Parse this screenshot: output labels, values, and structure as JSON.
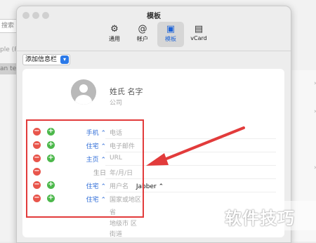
{
  "background": {
    "search_placeholder": "搜索",
    "list_item_1": "ple (P",
    "list_item_2": "an te"
  },
  "window": {
    "title": "模板",
    "tabs": [
      {
        "label": "通用",
        "icon": "gear-icon",
        "glyph": "⚙",
        "active": false
      },
      {
        "label": "帐户",
        "icon": "at-icon",
        "glyph": "@",
        "active": false
      },
      {
        "label": "模板",
        "icon": "template-icon",
        "glyph": "▣",
        "active": true
      },
      {
        "label": "vCard",
        "icon": "vcard-icon",
        "glyph": "▤",
        "active": false
      }
    ],
    "add_field_label": "添加信息栏"
  },
  "card": {
    "name_placeholder": "姓氏  名字",
    "company_placeholder": "公司",
    "rows": [
      {
        "label": "手机",
        "value": "电话",
        "minus": true,
        "plus": true,
        "chevron": true
      },
      {
        "label": "住宅",
        "value": "电子邮件",
        "minus": true,
        "plus": true,
        "chevron": true
      },
      {
        "label": "主页",
        "value": "URL",
        "minus": true,
        "plus": true,
        "chevron": true
      },
      {
        "label": "生日",
        "value": "年/月/日",
        "minus": true,
        "plus": false,
        "chevron": false
      },
      {
        "label": "住宅",
        "value": "用户名",
        "select": "Jabber",
        "minus": true,
        "plus": true,
        "chevron": true
      },
      {
        "label": "住宅",
        "value": "国家或地区",
        "minus": true,
        "plus": true,
        "chevron": true
      }
    ],
    "address_extra": [
      "省",
      "地级市  区",
      "街道"
    ]
  },
  "watermark": "软件技巧",
  "colors": {
    "annotation_red": "#e23b3b",
    "accent_blue": "#2f6dd8"
  }
}
